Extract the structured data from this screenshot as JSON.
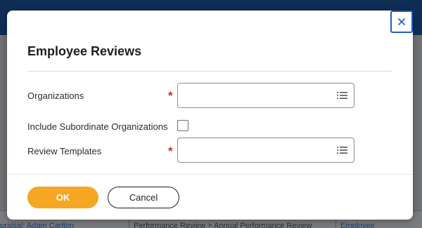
{
  "background": {
    "row": {
      "cell1": "praisal: Adam Carlton",
      "cell2": "Performance Review > Annual Performance Review",
      "cell3": "Employee"
    }
  },
  "dialog": {
    "title": "Employee Reviews",
    "close_icon": "close-icon",
    "fields": {
      "organizations": {
        "label": "Organizations",
        "required_marker": "*",
        "value": "",
        "icon": "list-prompt-icon"
      },
      "include_subordinate": {
        "label": "Include Subordinate Organizations",
        "checked": false
      },
      "review_templates": {
        "label": "Review Templates",
        "required_marker": "*",
        "value": "",
        "icon": "list-prompt-icon"
      }
    },
    "buttons": {
      "ok_label": "OK",
      "cancel_label": "Cancel"
    },
    "colors": {
      "primary_button": "#f5a623",
      "required": "#d42a1f",
      "focus_border": "#1d5ebd",
      "header": "#0f2e55"
    }
  }
}
